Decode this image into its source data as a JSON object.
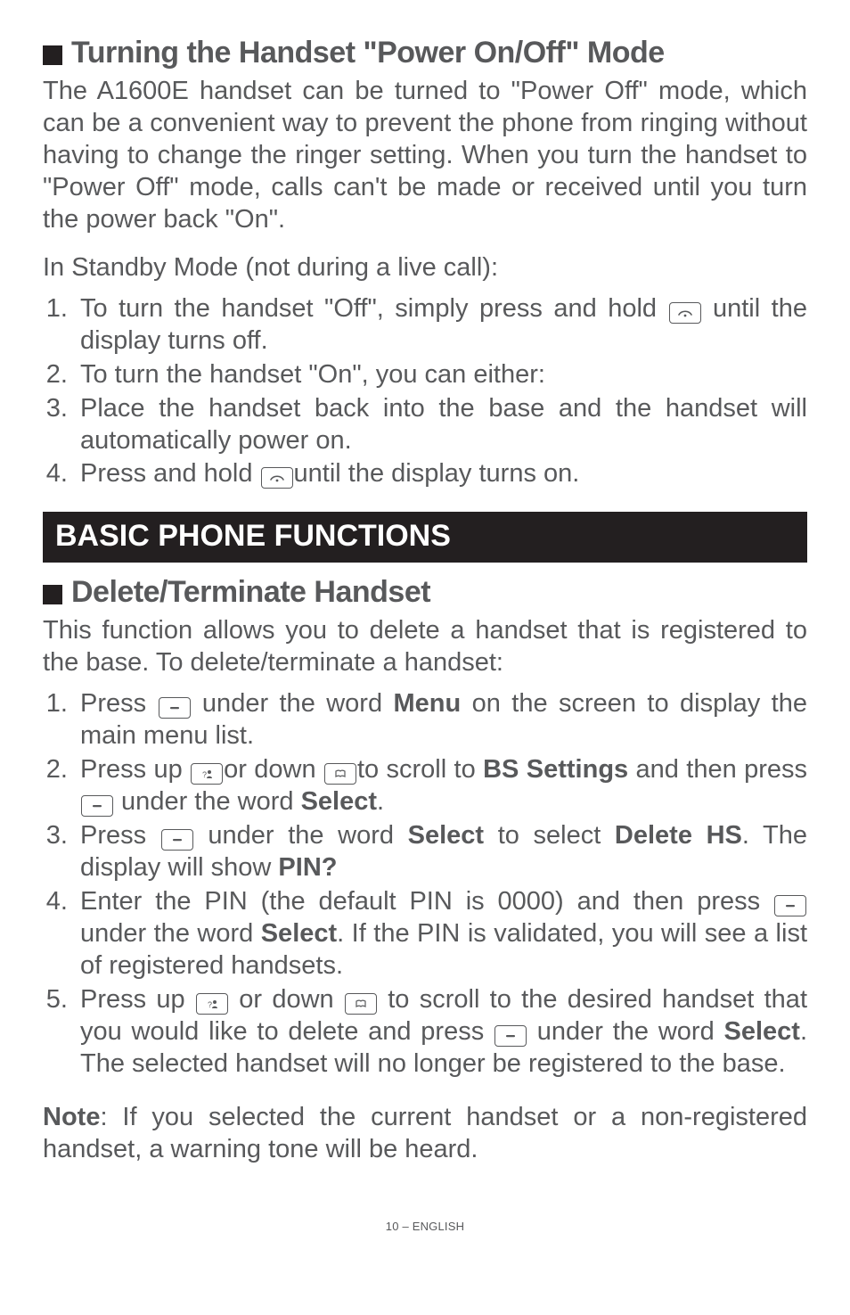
{
  "section1": {
    "heading": "Turning the Handset \"Power On/Off\" Mode",
    "paragraph": "The A1600E handset can be turned to \"Power Off\" mode, which can be a convenient way to prevent the phone from ringing without having to change the ringer setting.  When you turn the handset to \"Power Off\" mode, calls can't be made or received until you turn the power back \"On\".",
    "standby": "In Standby Mode (not during a live call):",
    "list": {
      "i1a": "To turn the handset \"Off\", simply press and hold ",
      "i1b": " until the display turns off.",
      "i2": "To turn the handset \"On\", you can either:",
      "i3": "Place the handset back into the base and the handset will automatically power on.",
      "i4a": "Press and hold ",
      "i4b": "until the display turns on."
    }
  },
  "bar": "BASIC PHONE FUNCTIONS",
  "section2": {
    "heading": "Delete/Terminate Handset",
    "paragraph": "This function allows you to delete a handset that is registered to the base.  To delete/terminate a handset:",
    "list": {
      "i1a": "Press ",
      "i1b": " under the word ",
      "i1c": "Menu",
      "i1d": " on the screen to display the main menu list.",
      "i2a": "Press up ",
      "i2b": "or down ",
      "i2c": "to scroll to ",
      "i2d": "BS Settings",
      "i2e": " and then press ",
      "i2f": " under the word ",
      "i2g": "Select",
      "i2h": ".",
      "i3a": "Press ",
      "i3b": " under the word ",
      "i3c": "Select",
      "i3d": " to select ",
      "i3e": "Delete HS",
      "i3f": ". The display will show ",
      "i3g": "PIN?",
      "i4a": "Enter the PIN (the default PIN is 0000) and then press ",
      "i4b": " under the word ",
      "i4c": "Select",
      "i4d": ".  If the PIN is validated, you will see a list of registered handsets.",
      "i5a": "Press up ",
      "i5b": " or down ",
      "i5c": " to scroll to the desired handset that you would like to delete and press ",
      "i5d": " under the word ",
      "i5e": "Select",
      "i5f": ". The selected handset will no longer be registered to the base."
    },
    "note_label": "Note",
    "note_body": ": If you selected the current handset or a non-registered handset, a warning tone will be heard."
  },
  "footer": "10 – ENGLISH"
}
